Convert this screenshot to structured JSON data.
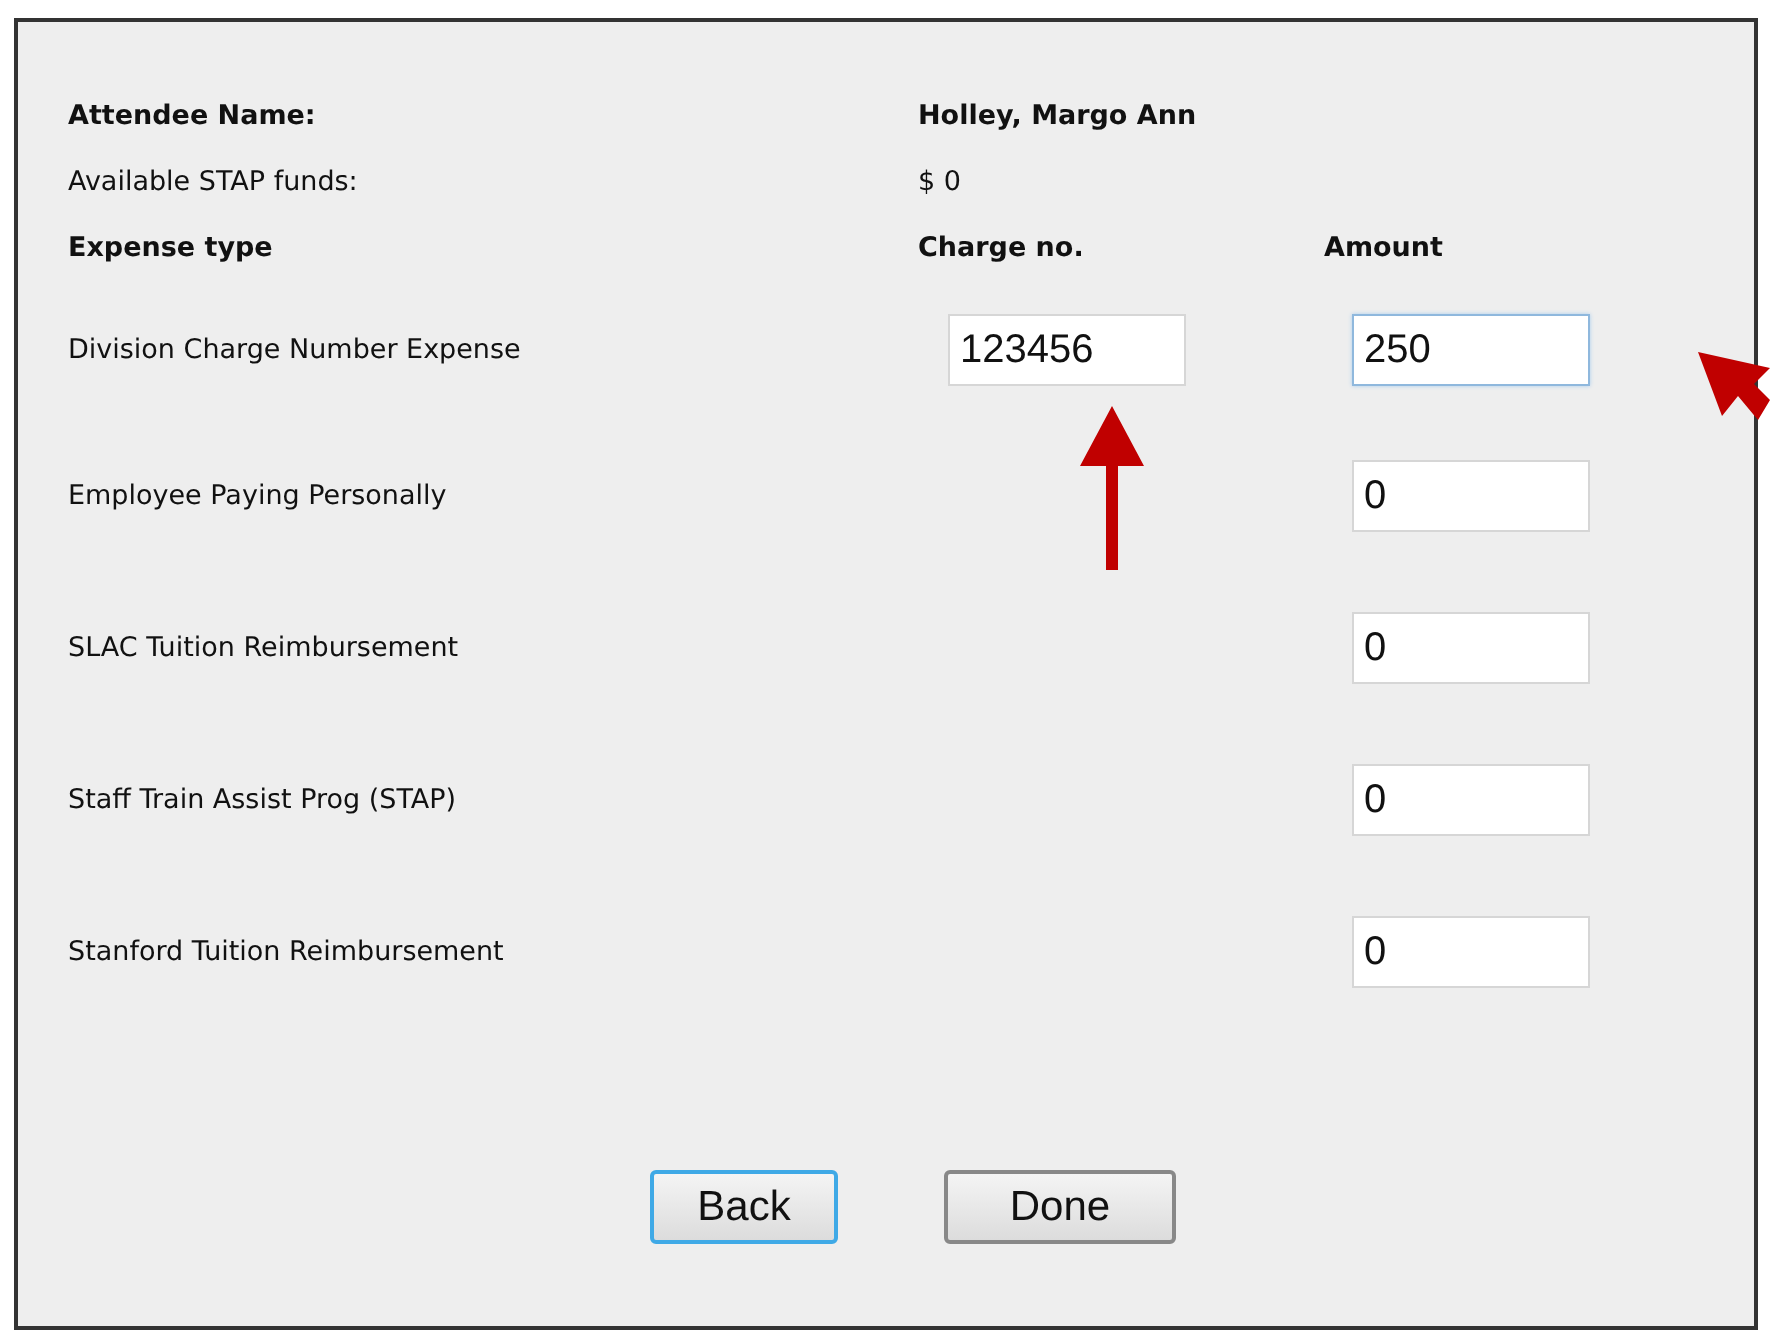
{
  "attendee": {
    "label": "Attendee Name:",
    "value": "Holley, Margo Ann"
  },
  "funds": {
    "label": "Available STAP funds:",
    "value": "$ 0"
  },
  "columns": [
    "Expense type",
    "Charge no.",
    "Amount"
  ],
  "expenses": [
    {
      "name": "Division Charge Number Expense",
      "charge_no": "123456",
      "amount": "250",
      "focused": true
    },
    {
      "name": "Employee Paying Personally",
      "amount": "0",
      "focused": false
    },
    {
      "name": "SLAC Tuition Reimbursement",
      "amount": "0",
      "focused": false
    },
    {
      "name": "Staff Train Assist Prog (STAP)",
      "amount": "0",
      "focused": false
    },
    {
      "name": "Stanford Tuition Reimbursement",
      "amount": "0",
      "focused": false
    }
  ],
  "buttons": [
    {
      "label": "Back",
      "focused": true
    },
    {
      "label": "Done",
      "focused": false
    }
  ]
}
